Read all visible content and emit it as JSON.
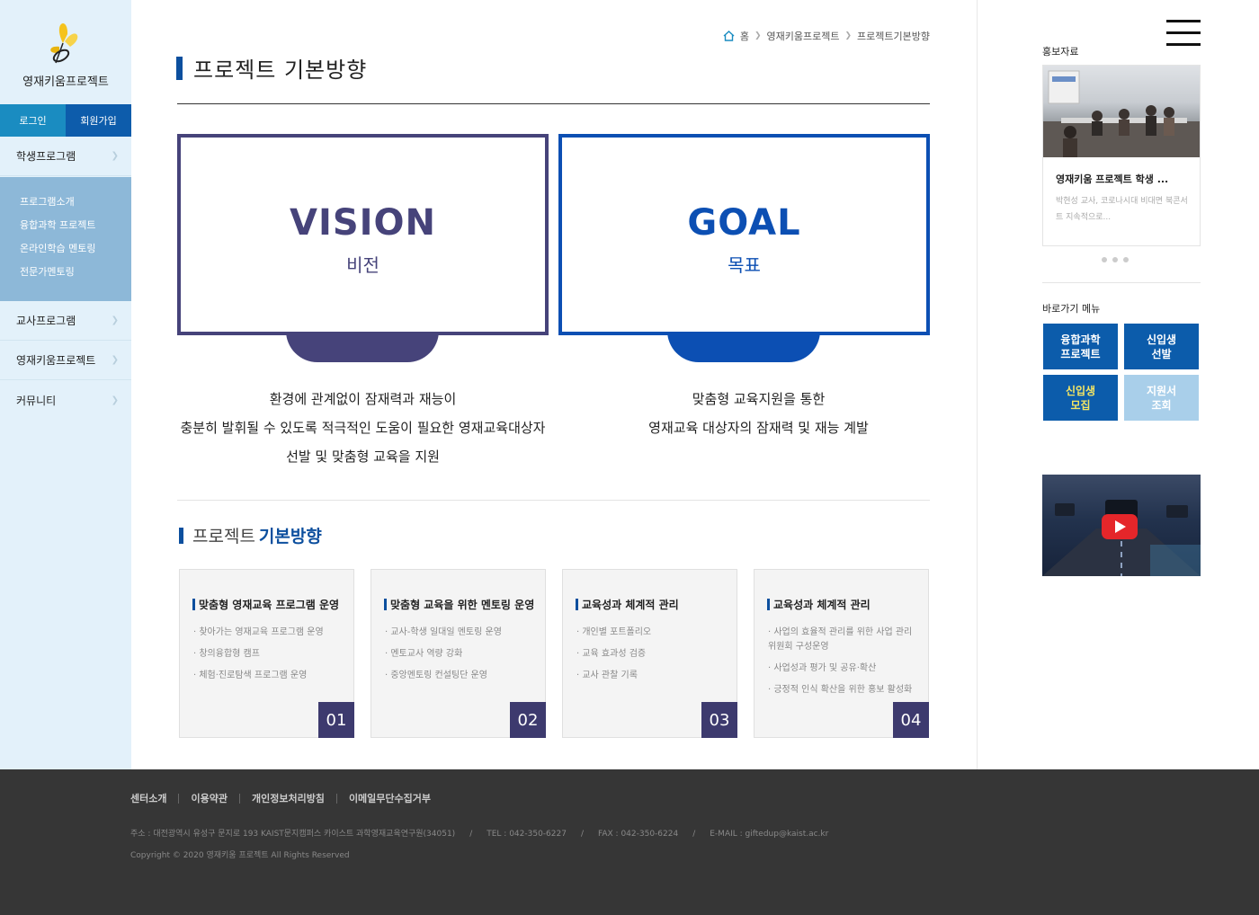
{
  "colors": {
    "vision": "#46437a",
    "goal": "#0c4fb3",
    "accent": "#0c4f9e",
    "card_num": "#3d3a6e"
  },
  "logo": {
    "title": "영재키움프로젝트"
  },
  "auth": {
    "login": "로그인",
    "join": "회원가입"
  },
  "nav": {
    "student": "학생프로그램",
    "student_sub": [
      "프로그램소개",
      "융합과학 프로젝트",
      "온라인학습 멘토링",
      "전문가멘토링"
    ],
    "teacher": "교사프로그램",
    "project": "영재키움프로젝트",
    "community": "커뮤니티"
  },
  "breadcrumb": {
    "home": "홈",
    "section": "영재키움프로젝트",
    "current": "프로젝트기본방향"
  },
  "page": {
    "title": "프로젝트 기본방향"
  },
  "vision": {
    "en": "VISION",
    "ko": "비전",
    "lines": [
      "환경에 관계없이 잠재력과 재능이",
      "충분히 발휘될 수 있도록 적극적인 도움이 필요한 영재교육대상자",
      "선발 및 맞춤형 교육을 지원"
    ]
  },
  "goal": {
    "en": "GOAL",
    "ko": "목표",
    "lines": [
      "맞춤형 교육지원을 통한",
      "영재교육 대상자의 잠재력 및 재능 계발"
    ]
  },
  "section": {
    "title_plain": "프로젝트",
    "title_bold": "기본방향"
  },
  "cards": [
    {
      "title": "맞춤형 영재교육 프로그램 운영",
      "items": [
        "· 찾아가는 영재교육 프로그램 운영",
        "· 창의융합형 캠프",
        "· 체험·진로탐색 프로그램 운영"
      ],
      "num": "01"
    },
    {
      "title": "맞춤형 교육을 위한 멘토링 운영",
      "items": [
        "· 교사-학생 일대일 멘토링 운영",
        "· 멘토교사 역량 강화",
        "· 중앙멘토링 컨설팅단 운영"
      ],
      "num": "02"
    },
    {
      "title": "교육성과 체계적 관리",
      "items": [
        "· 개인별 포트폴리오",
        "· 교육 효과성 검증",
        "· 교사 관찰 기록"
      ],
      "num": "03"
    },
    {
      "title": "교육성과 체계적 관리",
      "items": [
        "· 사업의 효율적 관리를 위한 사업 관리 위원회 구성운영",
        "· 사업성과 평가 및 공유·확산",
        "· 긍정적 인식 확산을 위한 홍보 활성화"
      ],
      "num": "04"
    }
  ],
  "right": {
    "promo_label": "홍보자료",
    "promo_title": "영재키움 프로젝트 학생 ...",
    "promo_desc": "박현성 교사, 코로나시대 비대면 북콘서트 지속적으로...",
    "quick_label": "바로가기 메뉴",
    "quick": [
      {
        "label": "융합과학\n프로젝트",
        "color": "#0c5cab",
        "text": "#ffffff"
      },
      {
        "label": "신입생\n선발",
        "color": "#0c5cab",
        "text": "#ffffff"
      },
      {
        "label": "신입생\n모집",
        "color": "#0c5cab",
        "text": "#f5e663"
      },
      {
        "label": "지원서\n조회",
        "color": "#a9cfea",
        "text": "#ffffff"
      }
    ]
  },
  "footer": {
    "links": [
      "센터소개",
      "이용약관",
      "개인정보처리방침",
      "이메일무단수집거부"
    ],
    "address": "주소 : 대전광역시 유성구 문지로 193 KAIST문지캠퍼스 카이스트 과학영재교육연구원(34051)",
    "tel": "TEL : 042-350-6227",
    "fax": "FAX : 042-350-6224",
    "email": "E-MAIL : giftedup@kaist.ac.kr",
    "copyright": "Copyright © 2020 영재키움 프로젝트 All Rights Reserved"
  }
}
